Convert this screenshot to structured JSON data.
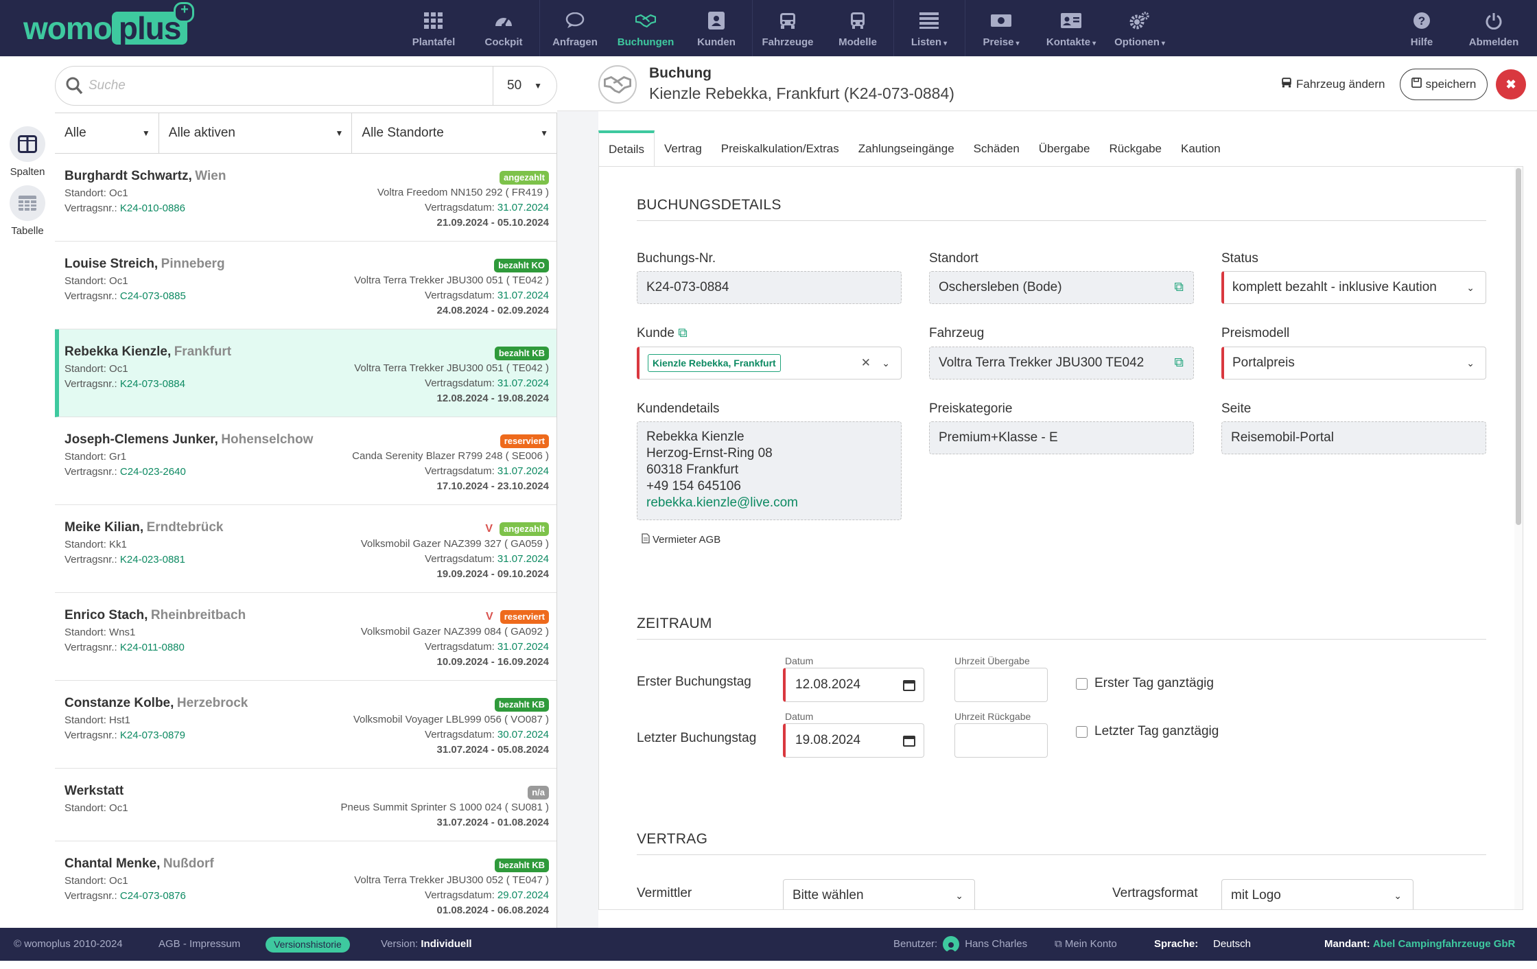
{
  "brand": {
    "left": "womo",
    "right": "plus"
  },
  "nav": {
    "items": [
      {
        "label": "Plantafel",
        "icon": "grid-icon"
      },
      {
        "label": "Cockpit",
        "icon": "gauge-icon"
      },
      {
        "label": "Anfragen",
        "icon": "chat-icon"
      },
      {
        "label": "Buchungen",
        "icon": "handshake-icon"
      },
      {
        "label": "Kunden",
        "icon": "person-card-icon"
      },
      {
        "label": "Fahrzeuge",
        "icon": "car-icon"
      },
      {
        "label": "Modelle",
        "icon": "bus-icon"
      },
      {
        "label": "Listen",
        "icon": "list-icon"
      },
      {
        "label": "Preise",
        "icon": "money-icon"
      },
      {
        "label": "Kontakte",
        "icon": "address-card-icon"
      },
      {
        "label": "Optionen",
        "icon": "gears-icon"
      },
      {
        "label": "Hilfe",
        "icon": "question-icon"
      },
      {
        "label": "Abmelden",
        "icon": "power-icon"
      }
    ],
    "active": "Buchungen"
  },
  "search": {
    "placeholder": "Suche",
    "page_size": "50"
  },
  "sidebar": {
    "spalten": "Spalten",
    "tabelle": "Tabelle"
  },
  "filters": {
    "f1": "Alle",
    "f2": "Alle aktiven",
    "f3": "Alle Standorte"
  },
  "list": [
    {
      "name": "Burghardt Schwartz,",
      "city": "Wien",
      "standort": "Standort: Oc1",
      "vnr_label": "Vertragsnr.:",
      "vnr": "K24-010-0886",
      "vmark": "",
      "badge": "angezahlt",
      "vehicle": "Voltra Freedom NN150 292 ( FR419 )",
      "vd_label": "Vertragsdatum:",
      "vd": "31.07.2024",
      "dates": "21.09.2024 - 05.10.2024"
    },
    {
      "name": "Louise Streich,",
      "city": "Pinneberg",
      "standort": "Standort: Oc1",
      "vnr_label": "Vertragsnr.:",
      "vnr": "C24-073-0885",
      "vmark": "",
      "badge": "bezahlt KO",
      "vehicle": "Voltra Terra Trekker JBU300 051 ( TE042 )",
      "vd_label": "Vertragsdatum:",
      "vd": "31.07.2024",
      "dates": "24.08.2024 - 02.09.2024"
    },
    {
      "name": "Rebekka Kienzle,",
      "city": "Frankfurt",
      "standort": "Standort: Oc1",
      "vnr_label": "Vertragsnr.:",
      "vnr": "K24-073-0884",
      "vmark": "",
      "badge": "bezahlt KB",
      "vehicle": "Voltra Terra Trekker JBU300 051 ( TE042 )",
      "vd_label": "Vertragsdatum:",
      "vd": "31.07.2024",
      "dates": "12.08.2024 - 19.08.2024"
    },
    {
      "name": "Joseph-Clemens Junker,",
      "city": "Hohenselchow",
      "standort": "Standort: Gr1",
      "vnr_label": "Vertragsnr.:",
      "vnr": "C24-023-2640",
      "vmark": "",
      "badge": "reserviert",
      "vehicle": "Canda Serenity Blazer R799 248 ( SE006 )",
      "vd_label": "Vertragsdatum:",
      "vd": "31.07.2024",
      "dates": "17.10.2024 - 23.10.2024"
    },
    {
      "name": "Meike Kilian,",
      "city": "Erndtebrück",
      "standort": "Standort: Kk1",
      "vnr_label": "Vertragsnr.:",
      "vnr": "K24-023-0881",
      "vmark": "V",
      "badge": "angezahlt",
      "vehicle": "Volksmobil Gazer NAZ399 327 ( GA059 )",
      "vd_label": "Vertragsdatum:",
      "vd": "31.07.2024",
      "dates": "19.09.2024 - 09.10.2024"
    },
    {
      "name": "Enrico Stach,",
      "city": "Rheinbreitbach",
      "standort": "Standort: Wns1",
      "vnr_label": "Vertragsnr.:",
      "vnr": "K24-011-0880",
      "vmark": "V",
      "badge": "reserviert",
      "vehicle": "Volksmobil Gazer NAZ399 084 ( GA092 )",
      "vd_label": "Vertragsdatum:",
      "vd": "31.07.2024",
      "dates": "10.09.2024 - 16.09.2024"
    },
    {
      "name": "Constanze Kolbe,",
      "city": "Herzebrock",
      "standort": "Standort: Hst1",
      "vnr_label": "Vertragsnr.:",
      "vnr": "K24-073-0879",
      "vmark": "",
      "badge": "bezahlt KB",
      "vehicle": "Volksmobil Voyager LBL999 056 ( VO087 )",
      "vd_label": "Vertragsdatum:",
      "vd": "30.07.2024",
      "dates": "31.07.2024 - 05.08.2024"
    },
    {
      "name": "Werkstatt",
      "city": "",
      "standort": "Standort: Oc1",
      "vnr_label": "",
      "vnr": "",
      "vmark": "",
      "badge": "n/a",
      "vehicle": "Pneus Summit Sprinter S 1000 024 ( SU081 )",
      "vd_label": "",
      "vd": "",
      "dates": "31.07.2024 - 01.08.2024"
    },
    {
      "name": "Chantal Menke,",
      "city": "Nußdorf",
      "standort": "Standort: Oc1",
      "vnr_label": "Vertragsnr.:",
      "vnr": "C24-073-0876",
      "vmark": "",
      "badge": "bezahlt KB",
      "vehicle": "Voltra Terra Trekker JBU300 052 ( TE047 )",
      "vd_label": "Vertragsdatum:",
      "vd": "29.07.2024",
      "dates": "01.08.2024 - 06.08.2024"
    }
  ],
  "header": {
    "title": "Buchung",
    "subtitle": "Kienzle Rebekka, Frankfurt (K24-073-0884)",
    "change_vehicle": "Fahrzeug ändern",
    "save": "speichern"
  },
  "tabs": [
    "Details",
    "Vertrag",
    "Preiskalkulation/Extras",
    "Zahlungseingänge",
    "Schäden",
    "Übergabe",
    "Rückgabe",
    "Kaution"
  ],
  "details": {
    "section": "BUCHUNGSDETAILS",
    "buchungsnr_label": "Buchungs-Nr.",
    "buchungsnr": "K24-073-0884",
    "standort_label": "Standort",
    "standort": "Oschersleben (Bode)",
    "status_label": "Status",
    "status": "komplett bezahlt - inklusive Kaution",
    "kunde_label": "Kunde",
    "kunde": "Kienzle Rebekka, Frankfurt",
    "fahrzeug_label": "Fahrzeug",
    "fahrzeug": "Voltra Terra Trekker JBU300 TE042",
    "preismodell_label": "Preismodell",
    "preismodell": "Portalpreis",
    "kundendetails_label": "Kundendetails",
    "kundendetails": [
      "Rebekka Kienzle",
      "Herzog-Ernst-Ring 08",
      "60318 Frankfurt",
      "+49 154 645106"
    ],
    "kunde_email": "rebekka.kienzle@live.com",
    "preiskategorie_label": "Preiskategorie",
    "preiskategorie": "Premium+Klasse - E",
    "seite_label": "Seite",
    "seite": "Reisemobil-Portal",
    "agb": "Vermieter AGB"
  },
  "zeitraum": {
    "section": "ZEITRAUM",
    "datum_label": "Datum",
    "erster_label": "Erster Buchungstag",
    "erster_date": "12.08.2024",
    "uhrzeit_ueber": "Uhrzeit Übergabe",
    "erster_ganz": "Erster Tag ganztägig",
    "letzter_label": "Letzter Buchungstag",
    "letzter_date": "19.08.2024",
    "uhrzeit_rueck": "Uhrzeit Rückgabe",
    "letzter_ganz": "Letzter Tag ganztägig"
  },
  "vertrag": {
    "section": "VERTRAG",
    "vermittler_label": "Vermittler",
    "vermittler": "Bitte wählen",
    "format_label": "Vertragsformat",
    "format": "mit Logo"
  },
  "footer": {
    "copyright": "© womoplus 2010-2024",
    "agb": "AGB - Impressum",
    "versionshistorie": "Versionshistorie",
    "version_label": "Version:",
    "version": "Individuell",
    "benutzer_label": "Benutzer:",
    "benutzer": "Hans Charles",
    "konto": "Mein Konto",
    "sprache_label": "Sprache:",
    "sprache": "Deutsch",
    "mandant_label": "Mandant:",
    "mandant": "Abel Campingfahrzeuge GbR"
  },
  "colors": {
    "nav_bg": "#25284a",
    "accent": "#3ec99f",
    "danger": "#d9383f"
  }
}
